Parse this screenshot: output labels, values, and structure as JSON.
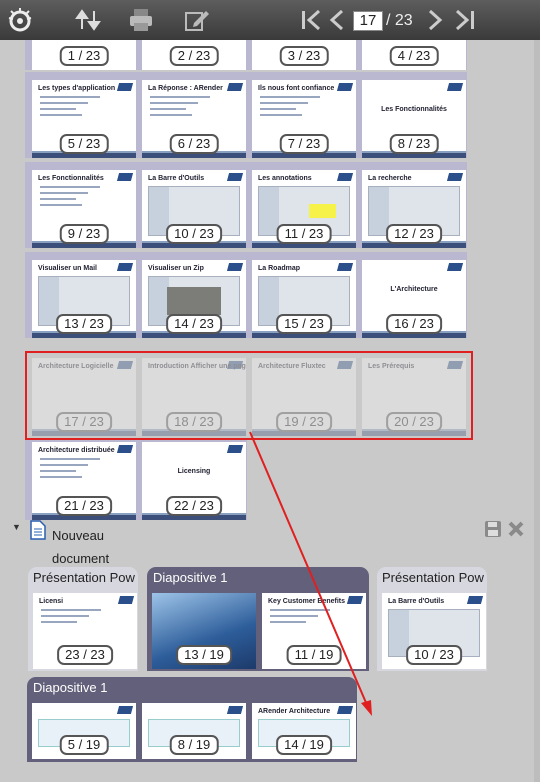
{
  "toolbar": {
    "current_page": "17",
    "total_pages": "/ 23"
  },
  "thumbnails": [
    {
      "label": "1 / 23"
    },
    {
      "label": "2 / 23"
    },
    {
      "label": "3 / 23"
    },
    {
      "label": "4 / 23"
    },
    {
      "label": "5 / 23",
      "title": "Les types d'application"
    },
    {
      "label": "6 / 23",
      "title": "La Réponse : ARender"
    },
    {
      "label": "7 / 23",
      "title": "Ils nous font confiance"
    },
    {
      "label": "8 / 23",
      "title": "Les Fonctionnalités"
    },
    {
      "label": "9 / 23",
      "title": "Les Fonctionnalités"
    },
    {
      "label": "10 / 23",
      "title": "La Barre d'Outils"
    },
    {
      "label": "11 / 23",
      "title": "Les annotations"
    },
    {
      "label": "12 / 23",
      "title": "La recherche"
    },
    {
      "label": "13 / 23",
      "title": "Visualiser un Mail"
    },
    {
      "label": "14 / 23",
      "title": "Visualiser un Zip"
    },
    {
      "label": "15 / 23",
      "title": "La Roadmap"
    },
    {
      "label": "16 / 23",
      "title": "L'Architecture"
    },
    {
      "label": "17 / 23",
      "title": "Architecture Logicielle"
    },
    {
      "label": "18 / 23",
      "title": "Introduction Afficher une page"
    },
    {
      "label": "19 / 23",
      "title": "Architecture Fluxtec"
    },
    {
      "label": "20 / 23",
      "title": "Les Prérequis"
    },
    {
      "label": "21 / 23",
      "title": "Architecture distribuée"
    },
    {
      "label": "22 / 23",
      "title": "Licensing"
    }
  ],
  "document": {
    "title": "Nouveau document"
  },
  "new_doc_groups": [
    {
      "title": "Présentation Pow",
      "thumbs": [
        {
          "label": "23 / 23",
          "title": "Licensi"
        }
      ]
    },
    {
      "title": "Diapositive 1",
      "thumbs": [
        {
          "label": "13 / 19"
        },
        {
          "label": "11 / 19",
          "title": "Key Customer Benefits"
        }
      ]
    },
    {
      "title": "Présentation Pow",
      "thumbs": [
        {
          "label": "10 / 23",
          "title": "La Barre d'Outils"
        }
      ]
    },
    {
      "title": "Diapositive 1",
      "thumbs": [
        {
          "label": "5 / 19"
        },
        {
          "label": "8 / 19"
        },
        {
          "label": "14 / 19",
          "title": "ARender Architecture"
        }
      ]
    }
  ],
  "colors": {
    "selection": "#e02020",
    "group": "#b9b8d0",
    "dark_group": "#62607a"
  },
  "icons": [
    "logo-icon",
    "sort-icon",
    "print-icon",
    "annotate-icon",
    "first-page-icon",
    "prev-page-icon",
    "next-page-icon",
    "last-page-icon",
    "document-icon",
    "save-icon",
    "close-icon"
  ]
}
